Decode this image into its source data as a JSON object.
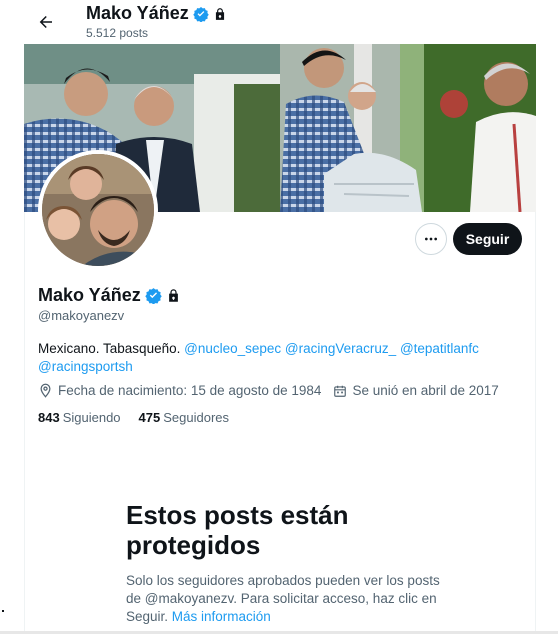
{
  "header": {
    "display_name": "Mako Yáñez",
    "posts_count": "5.512 posts"
  },
  "profile": {
    "display_name": "Mako Yáñez",
    "handle": "@makoyanezv",
    "bio_text": "Mexicano. Tabasqueño. ",
    "bio_mentions": [
      "@nucleo_sepec",
      "@racingVeracruz_",
      "@tepatitlanfc",
      "@racingsportsh"
    ],
    "birth": "Fecha de nacimiento: 15 de agosto de 1984",
    "joined": "Se unió en abril de 2017",
    "following_count": "843",
    "following_label": "Siguiendo",
    "followers_count": "475",
    "followers_label": "Seguidores"
  },
  "actions": {
    "follow_label": "Seguir"
  },
  "protected": {
    "title": "Estos posts están protegidos",
    "body": "Solo los seguidores aprobados pueden ver los posts de @makoyanezv. Para solicitar acceso, haz clic en Seguir. ",
    "link": "Más información"
  },
  "colors": {
    "accent": "#1d9bf0",
    "text": "#0f1419",
    "muted": "#536471",
    "button_dark": "#0f1419"
  },
  "icons": [
    "back-arrow-icon",
    "verified-badge-icon",
    "lock-icon",
    "more-icon",
    "location-icon",
    "calendar-icon"
  ]
}
